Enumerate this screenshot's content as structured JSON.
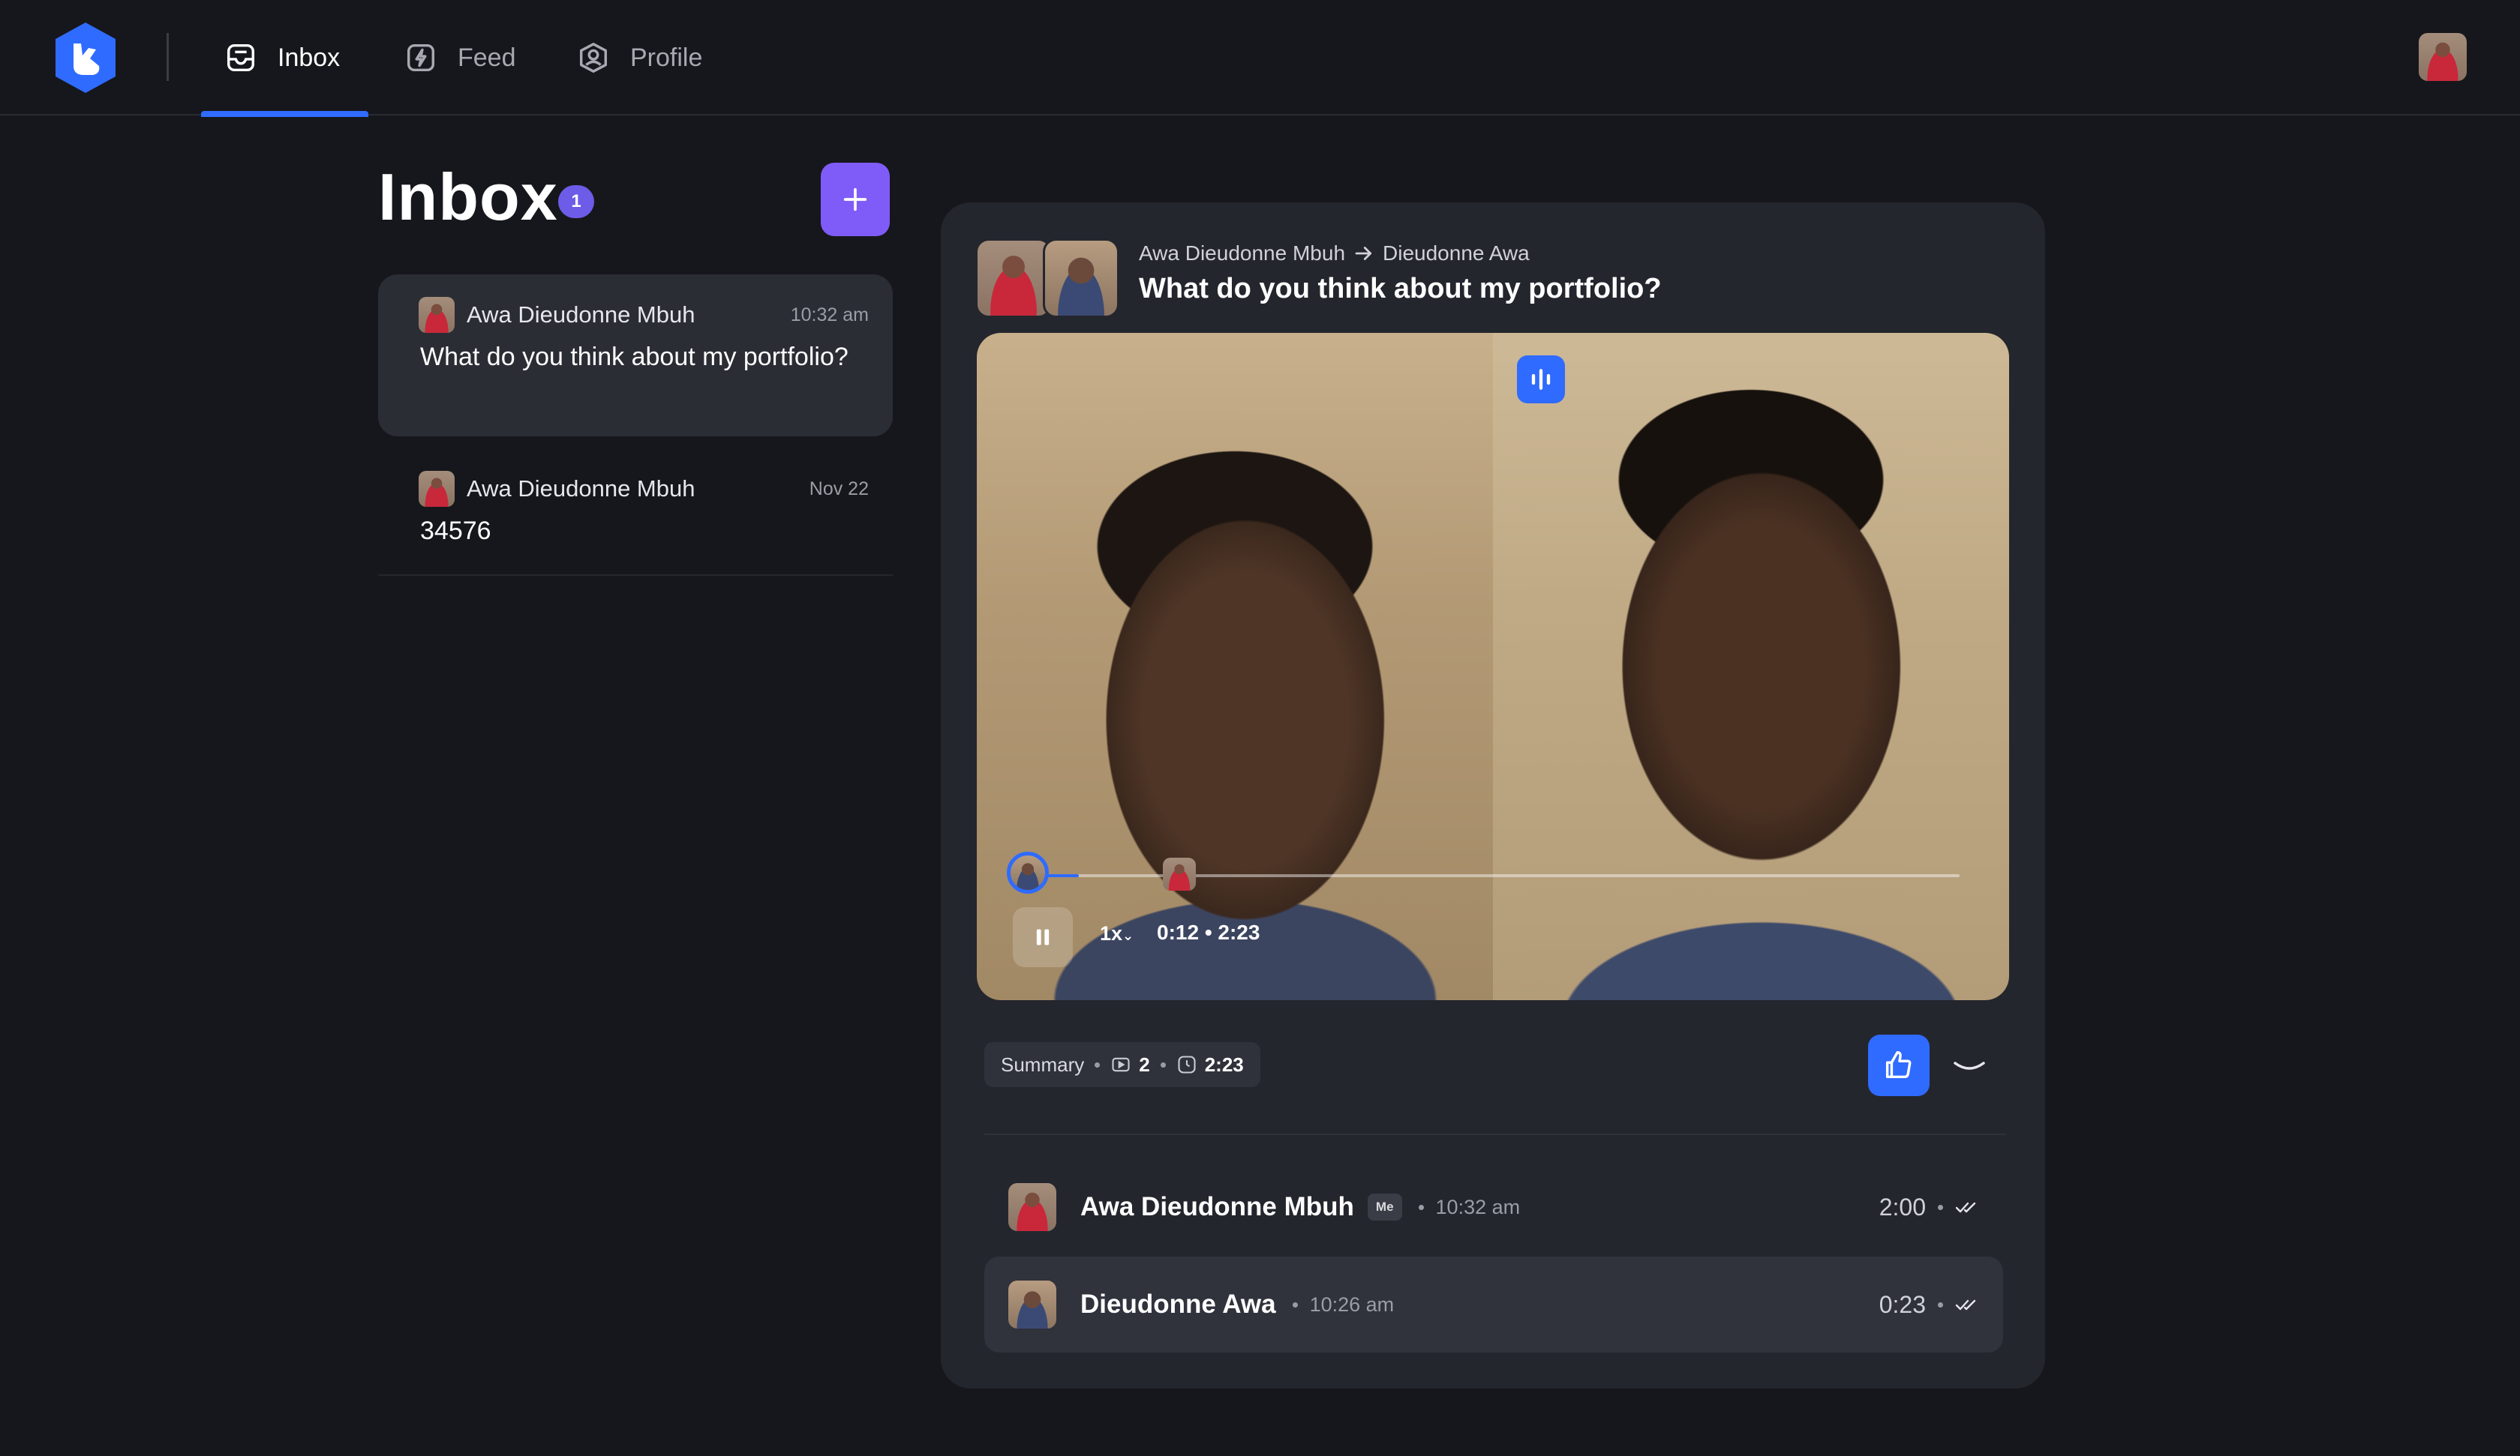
{
  "nav": {
    "tabs": [
      {
        "label": "Inbox",
        "icon": "inbox-icon",
        "active": true
      },
      {
        "label": "Feed",
        "icon": "feed-icon",
        "active": false
      },
      {
        "label": "Profile",
        "icon": "profile-icon",
        "active": false
      }
    ]
  },
  "inbox": {
    "title": "Inbox",
    "unread_count": "1",
    "threads": [
      {
        "sender": "Awa Dieudonne Mbuh",
        "time": "10:32 am",
        "body": "What do you think about my portfolio?",
        "selected": true
      },
      {
        "sender": "Awa Dieudonne Mbuh",
        "time": "Nov 22",
        "body": "34576",
        "selected": false
      }
    ]
  },
  "conversation": {
    "from": "Awa Dieudonne Mbuh",
    "to": "Dieudonne Awa",
    "subject": "What do you think about my portfolio?",
    "player": {
      "speed": "1x",
      "time": "0:12 • 2:23",
      "progress": 0.053
    },
    "summary": {
      "label": "Summary",
      "count": "2",
      "duration": "2:23"
    },
    "messages": [
      {
        "name": "Awa Dieudonne Mbuh",
        "tag": "Me",
        "time": "10:32 am",
        "duration": "2:00",
        "selected": false
      },
      {
        "name": "Dieudonne Awa",
        "tag": "",
        "time": "10:26 am",
        "duration": "0:23",
        "selected": true
      }
    ]
  },
  "colors": {
    "accent": "#2f6bff",
    "compose": "#7f5cf7",
    "badge": "#6c5ce7",
    "background": "#16171c",
    "card": "#24262e"
  }
}
